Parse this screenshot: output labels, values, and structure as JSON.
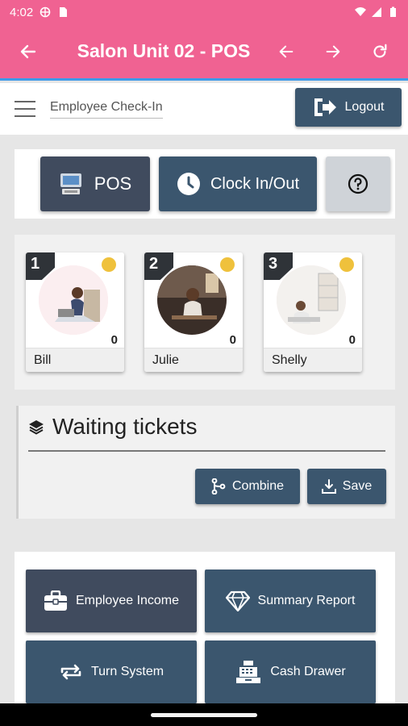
{
  "status": {
    "time": "4:02"
  },
  "appbar": {
    "title": "Salon Unit 02 - POS"
  },
  "header": {
    "breadcrumb": "Employee Check-In",
    "logout_label": "Logout"
  },
  "top_buttons": {
    "pos_label": "POS",
    "clock_label": "Clock In/Out"
  },
  "employees": [
    {
      "number": "1",
      "name": "Bill",
      "count": "0"
    },
    {
      "number": "2",
      "name": "Julie",
      "count": "0"
    },
    {
      "number": "3",
      "name": "Shelly",
      "count": "0"
    }
  ],
  "waiting": {
    "title": "Waiting tickets",
    "combine_label": "Combine",
    "save_label": "Save"
  },
  "grid": {
    "employee_income": "Employee Income",
    "summary_report": "Summary Report",
    "turn_system": "Turn System",
    "cash_drawer": "Cash Drawer"
  },
  "colors": {
    "appbar": "#f06292",
    "button_dark": "#3b566e",
    "button_slate": "#404b5e",
    "status_dot": "#efc13c"
  }
}
